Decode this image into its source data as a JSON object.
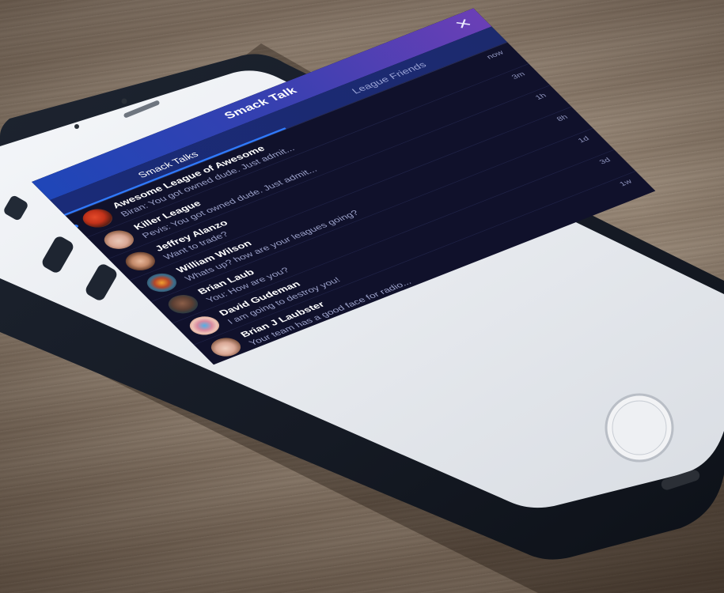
{
  "header": {
    "title": "Smack Talk",
    "close_icon": "close-icon"
  },
  "tabs": [
    {
      "label": "Smack Talks",
      "active": true
    },
    {
      "label": "League Friends",
      "active": false
    }
  ],
  "accent_color": "#2f7bff",
  "conversations": [
    {
      "name": "Awesome League of Awesome",
      "preview": "Biran: You got owned dude. Just admit...",
      "time": "now",
      "unread": true,
      "avatar": "avatar-football-player"
    },
    {
      "name": "Killer League",
      "preview": "Pevis: You got owned dude. Just admit...",
      "time": "3m",
      "unread": false,
      "avatar": "avatar-woman-headscarf"
    },
    {
      "name": "Jeffrey Alanzo",
      "preview": "Want to trade?",
      "time": "1h",
      "unread": false,
      "avatar": "avatar-face-closeup"
    },
    {
      "name": "William Wilson",
      "preview": "Whats up? how are your leagues going?",
      "time": "8h",
      "unread": false,
      "avatar": "avatar-owl"
    },
    {
      "name": "Brian Laub",
      "preview": "You: How are you?",
      "time": "1d",
      "unread": false,
      "avatar": "avatar-man-sunglasses"
    },
    {
      "name": "David Gudeman",
      "preview": "I am going to destroy you!",
      "time": "3d",
      "unread": false,
      "avatar": "avatar-woman-blue-glasses"
    },
    {
      "name": "Brian J Laubster",
      "preview": "Your team has a good face for radio...",
      "time": "1w",
      "unread": false,
      "avatar": "avatar-woman-headscarf-2"
    }
  ]
}
